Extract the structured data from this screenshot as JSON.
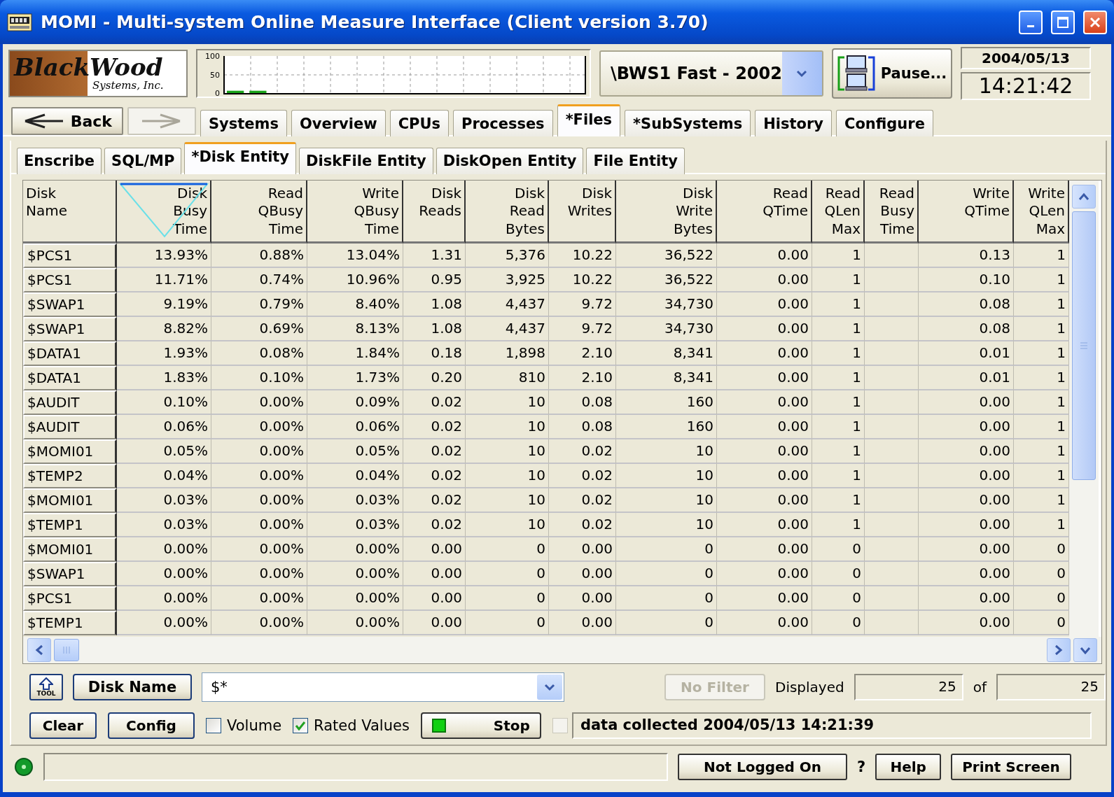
{
  "window": {
    "title": "MOMI - Multi-system Online Measure Interface (Client version 3.70)"
  },
  "header": {
    "logo": {
      "name_first": "Black",
      "name_second": "Wood",
      "tagline": "Systems, Inc."
    },
    "activity_chart": {
      "chart_data": {
        "type": "bar",
        "values": [
          8,
          8,
          null,
          null,
          null,
          null,
          null,
          null,
          null,
          null,
          null,
          null,
          null,
          null,
          null,
          null
        ],
        "ylim": [
          0,
          100
        ],
        "yticks": [
          0,
          50,
          100
        ]
      }
    },
    "system_select": {
      "value": "\\BWS1 Fast - 2002"
    },
    "pause_button": {
      "label": "Pause..."
    },
    "date": "2004/05/13",
    "time": "14:21:42"
  },
  "nav": {
    "back": {
      "label": "Back"
    },
    "forward": {
      "disabled": true
    },
    "tabs": [
      {
        "label": "Systems",
        "selected": false
      },
      {
        "label": "Overview",
        "selected": false
      },
      {
        "label": "CPUs",
        "selected": false
      },
      {
        "label": "Processes",
        "selected": false
      },
      {
        "label": "*Files",
        "selected": true
      },
      {
        "label": "*SubSystems",
        "selected": false
      },
      {
        "label": "History",
        "selected": false
      },
      {
        "label": "Configure",
        "selected": false
      }
    ]
  },
  "sub_tabs": [
    {
      "label": "Enscribe",
      "selected": false
    },
    {
      "label": "SQL/MP",
      "selected": false
    },
    {
      "label": "*Disk Entity",
      "selected": true
    },
    {
      "label": "DiskFile Entity",
      "selected": false
    },
    {
      "label": "DiskOpen Entity",
      "selected": false
    },
    {
      "label": "File Entity",
      "selected": false
    }
  ],
  "table": {
    "columns": [
      {
        "label": "Disk Name",
        "sorted": false
      },
      {
        "label": "Disk Busy Time",
        "sorted": true
      },
      {
        "label": "Read QBusy Time",
        "sorted": false
      },
      {
        "label": "Write QBusy Time",
        "sorted": false
      },
      {
        "label": "Disk Reads",
        "sorted": false
      },
      {
        "label": "Disk Read Bytes",
        "sorted": false
      },
      {
        "label": "Disk Writes",
        "sorted": false
      },
      {
        "label": "Disk Write Bytes",
        "sorted": false
      },
      {
        "label": "Read QTime",
        "sorted": false
      },
      {
        "label": "Read QLen Max",
        "sorted": false
      },
      {
        "label": "Read Busy Time",
        "sorted": false
      },
      {
        "label": "Write QTime",
        "sorted": false
      },
      {
        "label": "Write QLen Max",
        "sorted": false
      }
    ],
    "rows": [
      [
        "$PCS1",
        "13.93%",
        "0.88%",
        "13.04%",
        "1.31",
        "5,376",
        "10.22",
        "36,522",
        "0.00",
        "1",
        null,
        "0.13",
        "1"
      ],
      [
        "$PCS1",
        "11.71%",
        "0.74%",
        "10.96%",
        "0.95",
        "3,925",
        "10.22",
        "36,522",
        "0.00",
        "1",
        null,
        "0.10",
        "1"
      ],
      [
        "$SWAP1",
        "9.19%",
        "0.79%",
        "8.40%",
        "1.08",
        "4,437",
        "9.72",
        "34,730",
        "0.00",
        "1",
        null,
        "0.08",
        "1"
      ],
      [
        "$SWAP1",
        "8.82%",
        "0.69%",
        "8.13%",
        "1.08",
        "4,437",
        "9.72",
        "34,730",
        "0.00",
        "1",
        null,
        "0.08",
        "1"
      ],
      [
        "$DATA1",
        "1.93%",
        "0.08%",
        "1.84%",
        "0.18",
        "1,898",
        "2.10",
        "8,341",
        "0.00",
        "1",
        null,
        "0.01",
        "1"
      ],
      [
        "$DATA1",
        "1.83%",
        "0.10%",
        "1.73%",
        "0.20",
        "810",
        "2.10",
        "8,341",
        "0.00",
        "1",
        null,
        "0.01",
        "1"
      ],
      [
        "$AUDIT",
        "0.10%",
        "0.00%",
        "0.09%",
        "0.02",
        "10",
        "0.08",
        "160",
        "0.00",
        "1",
        null,
        "0.00",
        "1"
      ],
      [
        "$AUDIT",
        "0.06%",
        "0.00%",
        "0.06%",
        "0.02",
        "10",
        "0.08",
        "160",
        "0.00",
        "1",
        null,
        "0.00",
        "1"
      ],
      [
        "$MOMI01",
        "0.05%",
        "0.00%",
        "0.05%",
        "0.02",
        "10",
        "0.02",
        "10",
        "0.00",
        "1",
        null,
        "0.00",
        "1"
      ],
      [
        "$TEMP2",
        "0.04%",
        "0.00%",
        "0.04%",
        "0.02",
        "10",
        "0.02",
        "10",
        "0.00",
        "1",
        null,
        "0.00",
        "1"
      ],
      [
        "$MOMI01",
        "0.03%",
        "0.00%",
        "0.03%",
        "0.02",
        "10",
        "0.02",
        "10",
        "0.00",
        "1",
        null,
        "0.00",
        "1"
      ],
      [
        "$TEMP1",
        "0.03%",
        "0.00%",
        "0.03%",
        "0.02",
        "10",
        "0.02",
        "10",
        "0.00",
        "1",
        null,
        "0.00",
        "1"
      ],
      [
        "$MOMI01",
        "0.00%",
        "0.00%",
        "0.00%",
        "0.00",
        "0",
        "0.00",
        "0",
        "0.00",
        "0",
        null,
        "0.00",
        "0"
      ],
      [
        "$SWAP1",
        "0.00%",
        "0.00%",
        "0.00%",
        "0.00",
        "0",
        "0.00",
        "0",
        "0.00",
        "0",
        null,
        "0.00",
        "0"
      ],
      [
        "$PCS1",
        "0.00%",
        "0.00%",
        "0.00%",
        "0.00",
        "0",
        "0.00",
        "0",
        "0.00",
        "0",
        null,
        "0.00",
        "0"
      ],
      [
        "$TEMP1",
        "0.00%",
        "0.00%",
        "0.00%",
        "0.00",
        "0",
        "0.00",
        "0",
        "0.00",
        "0",
        null,
        "0.00",
        "0"
      ]
    ]
  },
  "filter": {
    "tool_button": {
      "label": "TOOL"
    },
    "field_button": {
      "label": "Disk Name"
    },
    "pattern": {
      "value": "$*"
    },
    "no_filter": {
      "label": "No Filter",
      "disabled": true
    },
    "displayed_label": "Displayed",
    "displayed": "25",
    "of_label": "of",
    "total": "25"
  },
  "controls": {
    "clear": {
      "label": "Clear"
    },
    "config": {
      "label": "Config"
    },
    "checkboxes": [
      {
        "label": "Volume",
        "checked": false
      },
      {
        "label": "Rated Values",
        "checked": true
      }
    ],
    "stop": {
      "label": "Stop"
    },
    "auto_check": {
      "checked": false,
      "disabled": true
    },
    "status_message": "data collected 2004/05/13 14:21:39"
  },
  "status_bar": {
    "connected": true,
    "login_button": {
      "label": "Not Logged On"
    },
    "question_mark": "?",
    "help": {
      "label": "Help"
    },
    "print": {
      "label": "Print Screen"
    }
  }
}
